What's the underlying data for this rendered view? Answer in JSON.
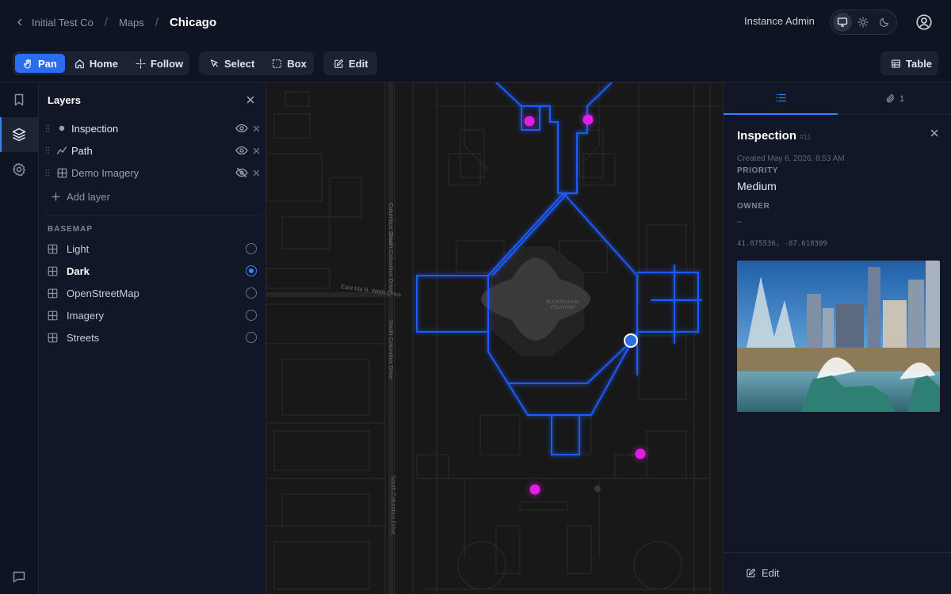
{
  "header": {
    "breadcrumbs": [
      "Initial Test Co",
      "Maps"
    ],
    "current": "Chicago",
    "user_role": "Instance Admin",
    "theme_modes": [
      "monitor-icon",
      "sun-icon",
      "moon-icon"
    ],
    "active_theme": "monitor-icon"
  },
  "toolbar": {
    "nav": {
      "pan": "Pan",
      "home": "Home",
      "follow": "Follow"
    },
    "selection": {
      "select": "Select",
      "box": "Box"
    },
    "edit": "Edit",
    "table": "Table"
  },
  "layers": {
    "title": "Layers",
    "items": [
      {
        "label": "Inspection",
        "icon": "point-icon",
        "visible": true
      },
      {
        "label": "Path",
        "icon": "line-icon",
        "visible": true
      },
      {
        "label": "Demo Imagery",
        "icon": "grid-icon",
        "visible": false
      }
    ],
    "add_label": "Add layer",
    "basemap_label": "BASEMAP",
    "basemaps": [
      "Light",
      "Dark",
      "OpenStreetMap",
      "Imagery",
      "Streets"
    ],
    "selected_basemap": "Dark"
  },
  "map": {
    "labels": {
      "fountain": [
        "BUCKINGHAM",
        "FOUNTAIN"
      ],
      "street_ida": "East Ida B. Wells Drive",
      "street_columbus_a": "Columbus Drive",
      "street_columbus_b": "South Columbus Drive",
      "street_columbus_c": "South Columbus Drive",
      "street_columbus_d": "South Columbus Drive"
    },
    "colors": {
      "feature_point": "#e01ee6",
      "path": "#1f5bff",
      "selected_point": "#2f6fe0"
    }
  },
  "detail": {
    "tabs": [
      {
        "icon": "list-icon",
        "label": ""
      },
      {
        "icon": "paperclip-icon",
        "label": "1"
      }
    ],
    "title": "Inspection",
    "id": "#11",
    "created": "Created May 6, 2026, 8:53 AM",
    "priority_label": "PRIORITY",
    "priority_value": "Medium",
    "owner_label": "OWNER",
    "owner_value": "–",
    "coords": "41.875536, -87.618309",
    "edit_label": "Edit"
  }
}
